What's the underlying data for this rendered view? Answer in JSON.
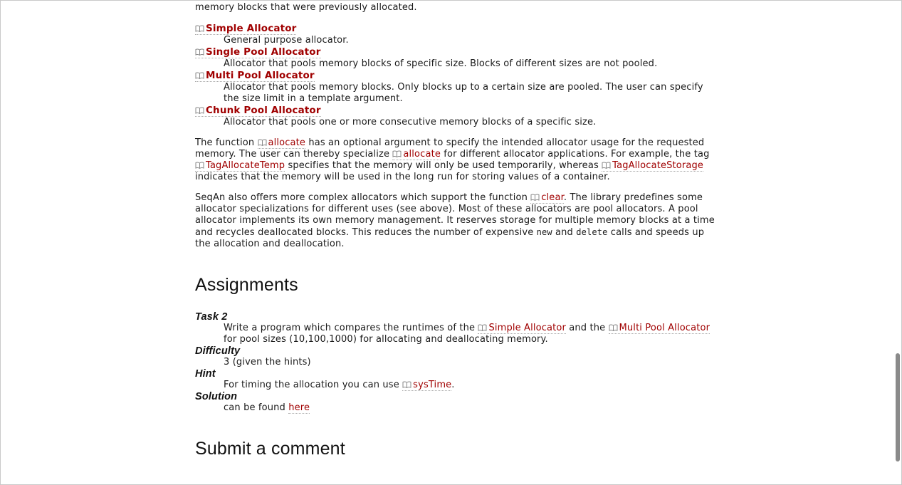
{
  "intro_tail": "memory blocks that were previously allocated.",
  "allocators": [
    {
      "name": "Simple Allocator",
      "desc": "General purpose allocator."
    },
    {
      "name": "Single Pool Allocator",
      "desc": "Allocator that pools memory blocks of specific size. Blocks of different sizes are not pooled."
    },
    {
      "name": "Multi Pool Allocator",
      "desc": "Allocator that pools memory blocks. Only blocks up to a certain size are pooled. The user can specify the size limit in a template argument."
    },
    {
      "name": "Chunk Pool Allocator",
      "desc": "Allocator that pools one or more consecutive memory blocks of a specific size."
    }
  ],
  "para1": {
    "t1": "The function ",
    "link1": "allocate",
    "t2": " has an optional argument to specify the intended allocator usage for the requested memory. The user can thereby specialize ",
    "link2": "allocate",
    "t3": " for different allocator applications. For example, the tag ",
    "link3": "TagAllocateTemp",
    "t4": " specifies that the memory will only be used temporarily, whereas ",
    "link4": "TagAllocateStorage",
    "t5": " indicates that the memory will be used in the long run for storing values of a container."
  },
  "para2": {
    "t1": "SeqAn also offers more complex allocators which support the function ",
    "link1": "clear",
    "t2": ". The library predefines some allocator specializations for different uses (see above). Most of these allocators are pool allocators. A pool allocator implements its own memory management. It reserves storage for multiple memory blocks at a time and recycles deallocated blocks. This reduces the number of expensive ",
    "code1": "new",
    "t3": " and ",
    "code2": "delete",
    "t4": " calls and speeds up the allocation and deallocation."
  },
  "assignments_heading": "Assignments",
  "task": {
    "label": "Task 2",
    "t1": "Write a program which compares the runtimes of the ",
    "link1": "Simple Allocator",
    "t2": " and the ",
    "link2": "Multi Pool Allocator",
    "t3": " for pool sizes (10,100,1000) for allocating and deallocating memory."
  },
  "difficulty": {
    "label": "Difficulty",
    "value": "3 (given the hints)"
  },
  "hint": {
    "label": "Hint",
    "t1": "For timing the allocation you can use ",
    "link1": "sysTime",
    "t2": "."
  },
  "solution": {
    "label": "Solution",
    "t1": "can be found ",
    "link1": "here"
  },
  "comment_heading": "Submit a comment",
  "icon": "book-icon",
  "colors": {
    "link": "#a00000",
    "text": "#1a1a1a",
    "scroll_thumb": "#8a8a8a"
  }
}
